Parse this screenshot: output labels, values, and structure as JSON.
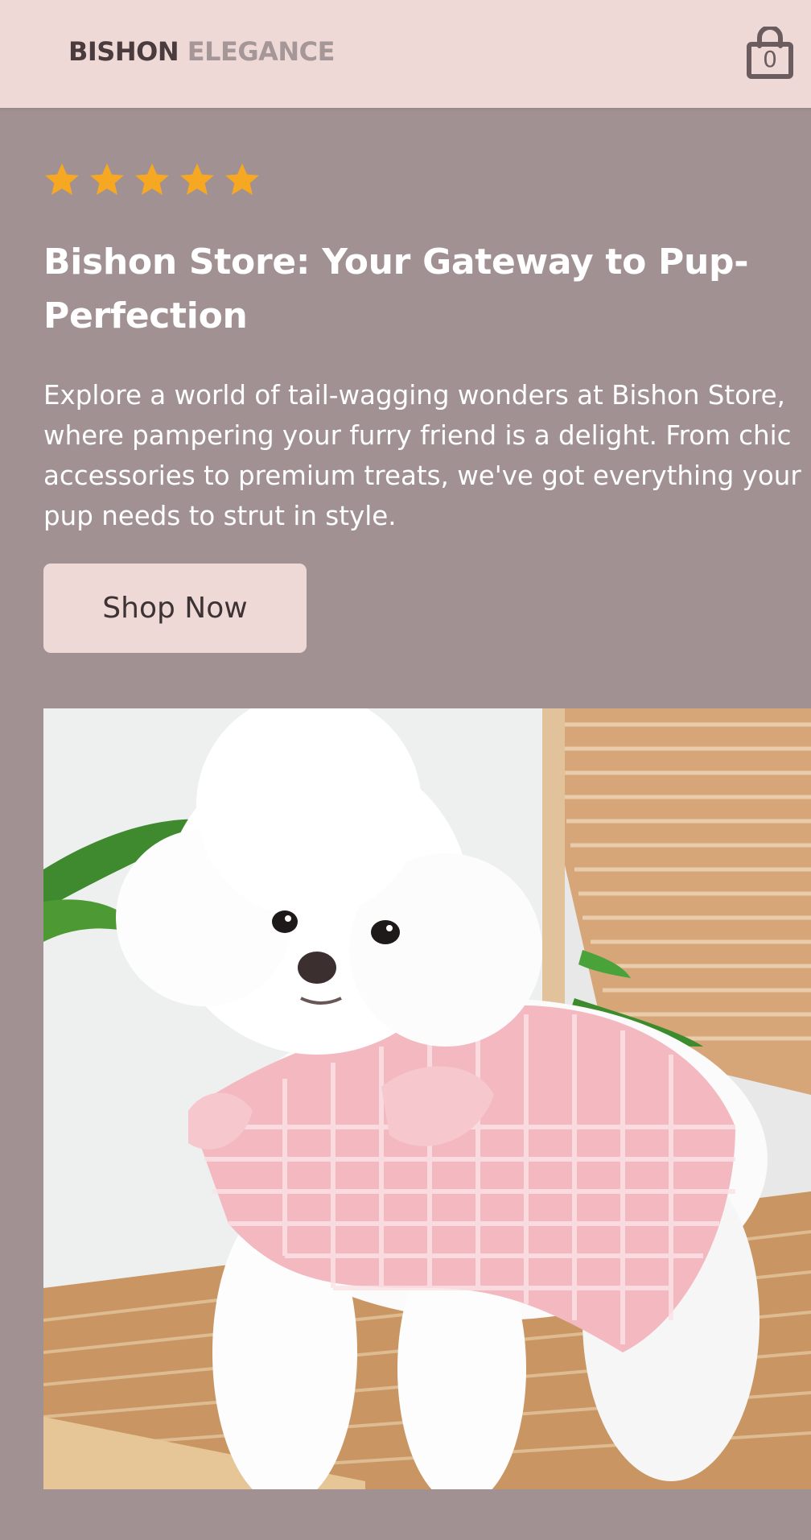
{
  "header": {
    "logo_part1": "BISHON",
    "logo_part2": "ELEGANCE",
    "cart_icon": "shopping-bag-icon",
    "cart_count": "0"
  },
  "hero": {
    "rating": 5,
    "rating_max": 5,
    "star_icon": "star-icon",
    "title": "Bishon Store: Your Gateway to Pup-Perfection",
    "description_lines": [
      "Explore a world of tail-wagging wonders at Bishon Store,",
      "where pampering your furry friend is a delight. From chic",
      "accessories to premium treats, we've got everything your",
      "pup needs to strut in style."
    ],
    "cta_label": "Shop Now"
  },
  "colors": {
    "header_bg": "#efd9d7",
    "page_bg": "#a19192",
    "star": "#f7a823",
    "button_bg": "#efd9d7",
    "text_light": "#ffffff",
    "logo_dark": "#4a3c3e",
    "logo_light": "#a59798"
  }
}
